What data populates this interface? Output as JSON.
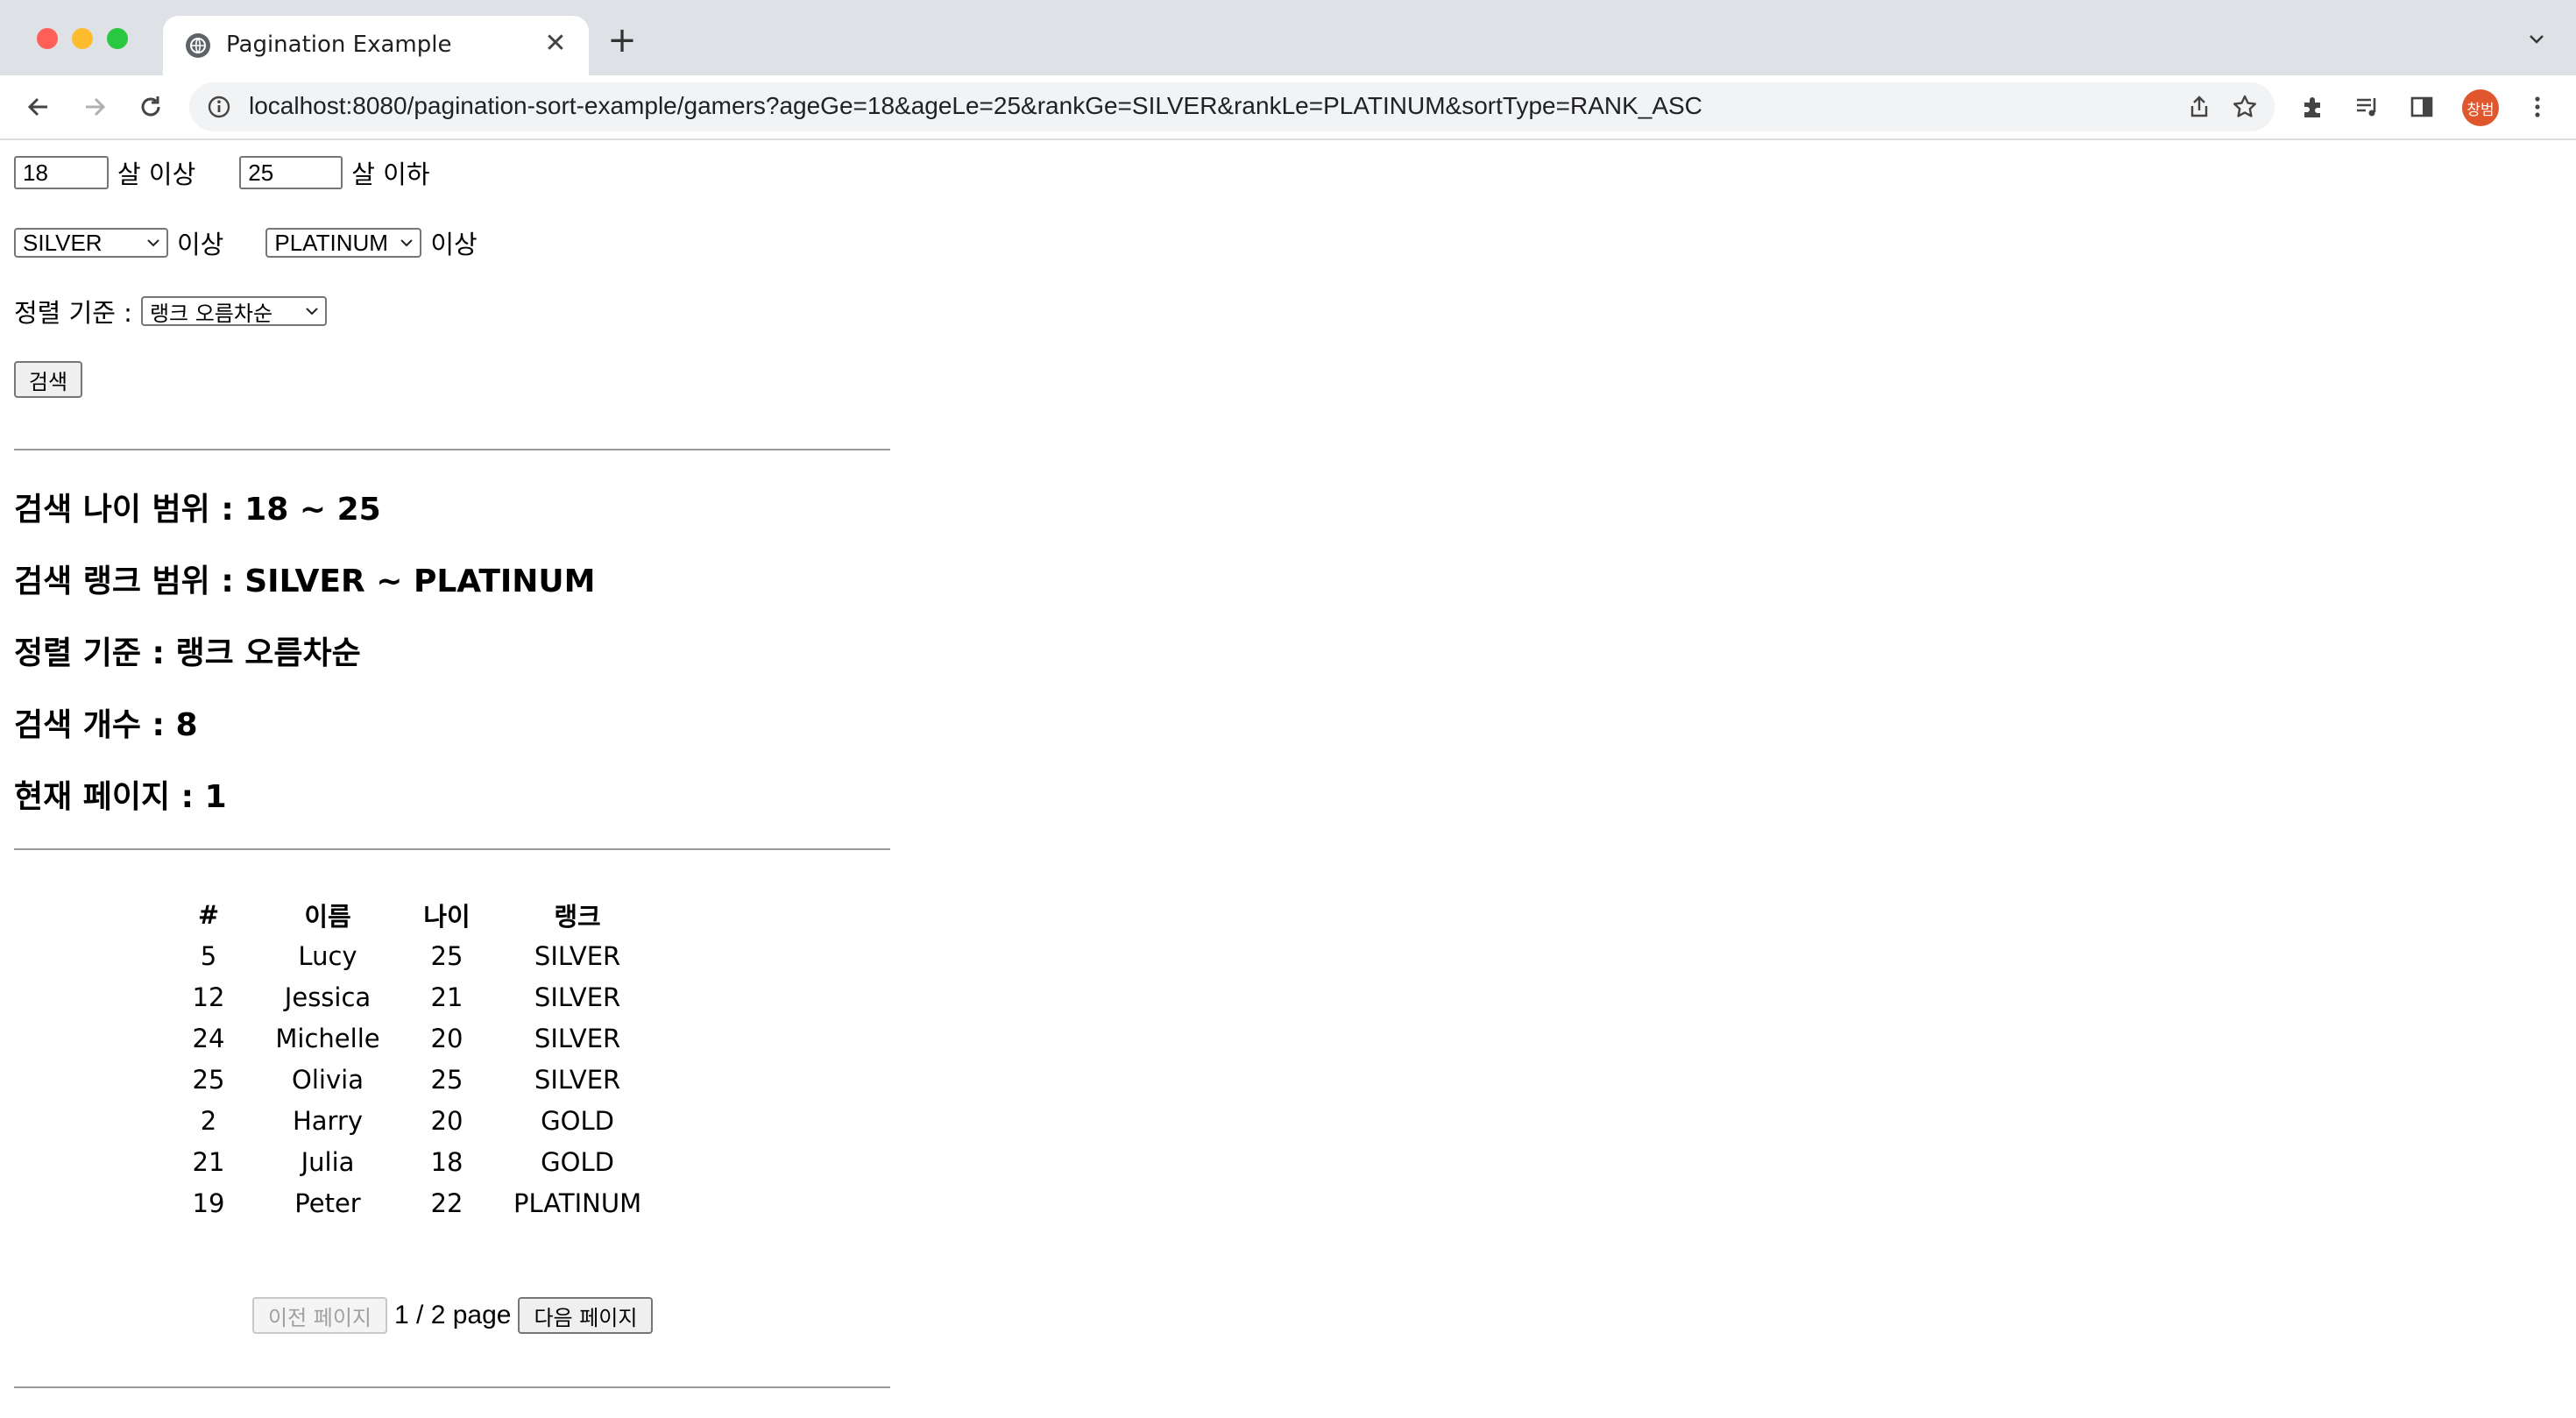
{
  "browser": {
    "tab_title": "Pagination Example",
    "url": "localhost:8080/pagination-sort-example/gamers?ageGe=18&ageLe=25&rankGe=SILVER&rankLe=PLATINUM&sortType=RANK_ASC",
    "profile_initial": "창범"
  },
  "form": {
    "age_min_value": "18",
    "age_min_suffix": "살 이상",
    "age_max_value": "25",
    "age_max_suffix": "살 이하",
    "rank_min_value": "SILVER",
    "rank_min_suffix": "이상",
    "rank_max_value": "PLATINUM",
    "rank_max_suffix": "이상",
    "sort_label": "정렬 기준 :",
    "sort_value": "랭크 오름차순",
    "search_button": "검색"
  },
  "summary": {
    "age_range": "검색 나이 범위 : 18 ~ 25",
    "rank_range": "검색 랭크 범위 : SILVER ~ PLATINUM",
    "sort": "정렬 기준 : 랭크 오름차순",
    "count": "검색 개수 : 8",
    "current_page": "현재 페이지 : 1"
  },
  "table": {
    "headers": [
      "#",
      "이름",
      "나이",
      "랭크"
    ],
    "rows": [
      [
        "5",
        "Lucy",
        "25",
        "SILVER"
      ],
      [
        "12",
        "Jessica",
        "21",
        "SILVER"
      ],
      [
        "24",
        "Michelle",
        "20",
        "SILVER"
      ],
      [
        "25",
        "Olivia",
        "25",
        "SILVER"
      ],
      [
        "2",
        "Harry",
        "20",
        "GOLD"
      ],
      [
        "21",
        "Julia",
        "18",
        "GOLD"
      ],
      [
        "19",
        "Peter",
        "22",
        "PLATINUM"
      ]
    ]
  },
  "pagination": {
    "prev_label": "이전 페이지",
    "info": "1 / 2 page",
    "next_label": "다음 페이지"
  }
}
